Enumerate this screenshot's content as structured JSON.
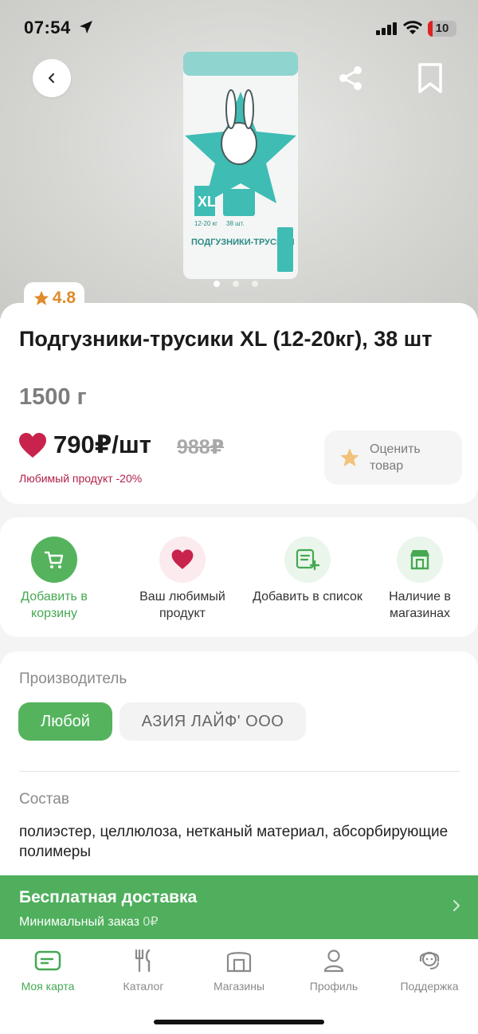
{
  "status": {
    "time": "07:54",
    "battery": "10"
  },
  "product": {
    "rating": "4.8",
    "title": "Подгузники-трусики XL (12-20кг), 38 шт",
    "weight": "1500 г",
    "price": "790₽/шт",
    "old_price": "988₽",
    "discount_label": "Любимый продукт -20%",
    "rate_label": "Оценить товар",
    "image_text": {
      "size": "XL",
      "weight_range": "12-20 кг",
      "count": "38 шт.",
      "name": "ПОДГУЗНИКИ-ТРУСИКИ"
    }
  },
  "actions": [
    {
      "label": "Добавить в корзину"
    },
    {
      "label": "Ваш любимый продукт"
    },
    {
      "label": "Добавить в список"
    },
    {
      "label": "Наличие в магазинах"
    }
  ],
  "manufacturer": {
    "title": "Производитель",
    "options": [
      "Любой",
      "АЗИЯ ЛАЙФ' ООО"
    ]
  },
  "composition": {
    "title": "Состав",
    "text": "полиэстер, целлюлоза, нетканый материал, абсорбирующие полимеры"
  },
  "delivery": {
    "title": "Бесплатная доставка",
    "min_label": "Минимальный заказ",
    "min_value": "0₽"
  },
  "tabs": [
    {
      "label": "Моя карта"
    },
    {
      "label": "Каталог"
    },
    {
      "label": "Магазины"
    },
    {
      "label": "Профиль"
    },
    {
      "label": "Поддержка"
    }
  ],
  "colors": {
    "accent": "#4faf5c",
    "heart": "#c8234c",
    "star": "#e08a2a"
  }
}
